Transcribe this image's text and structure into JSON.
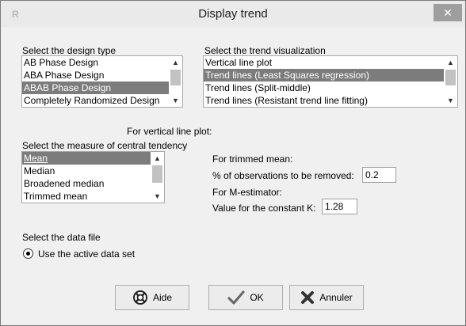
{
  "window": {
    "title": "Display trend",
    "app_icon_text": "R",
    "close_glyph": "✕"
  },
  "design": {
    "label": "Select the design type",
    "items": [
      "AB Phase Design",
      "ABA Phase Design",
      "ABAB Phase Design",
      "Completely Randomized Design"
    ],
    "selected": "ABAB Phase Design"
  },
  "trend": {
    "label": "Select the trend visualization",
    "items": [
      "Vertical line plot",
      "Trend lines (Least Squares regression)",
      "Trend lines (Split-middle)",
      "Trend lines (Resistant trend line fitting)"
    ],
    "selected": "Trend lines (Least Squares regression)"
  },
  "vertical": {
    "heading": "For vertical line plot:"
  },
  "central": {
    "label": "Select the measure of central tendency",
    "items": [
      "Mean",
      "Median",
      "Broadened median",
      "Trimmed mean"
    ],
    "selected": "Mean"
  },
  "trimmed": {
    "heading": "For trimmed mean:",
    "pct_label": "% of observations to be removed:",
    "pct_value": "0.2"
  },
  "mest": {
    "heading": "For M-estimator:",
    "k_label": "Value for the constant K:",
    "k_value": "1.28"
  },
  "datafile": {
    "label": "Select the data file",
    "option": "Use the active data set"
  },
  "buttons": {
    "help": "Aide",
    "ok": "OK",
    "cancel": "Annuler"
  },
  "colors": {
    "selection": "#7c7c7c",
    "window_bg": "#f0f0f0"
  }
}
